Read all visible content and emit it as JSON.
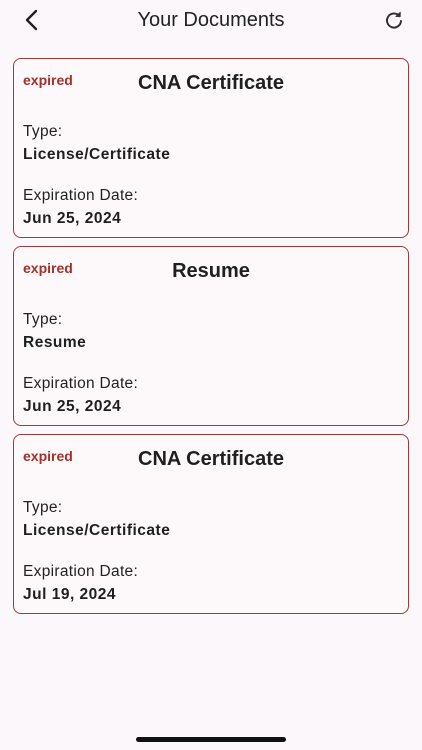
{
  "header": {
    "title": "Your Documents",
    "back_icon": "chevron-left-icon",
    "refresh_icon": "refresh-icon"
  },
  "colors": {
    "background": "#fcf7fa",
    "card_border": "#9b3a3a",
    "status_text": "#a3302a"
  },
  "labels": {
    "type": "Type:",
    "expiration": "Expiration Date:"
  },
  "documents": [
    {
      "status": "expired",
      "title": "CNA Certificate",
      "type": "License/Certificate",
      "expiration": "Jun 25, 2024"
    },
    {
      "status": "expired",
      "title": "Resume",
      "type": "Resume",
      "expiration": "Jun 25, 2024"
    },
    {
      "status": "expired",
      "title": "CNA Certificate",
      "type": "License/Certificate",
      "expiration": "Jul 19, 2024"
    }
  ]
}
